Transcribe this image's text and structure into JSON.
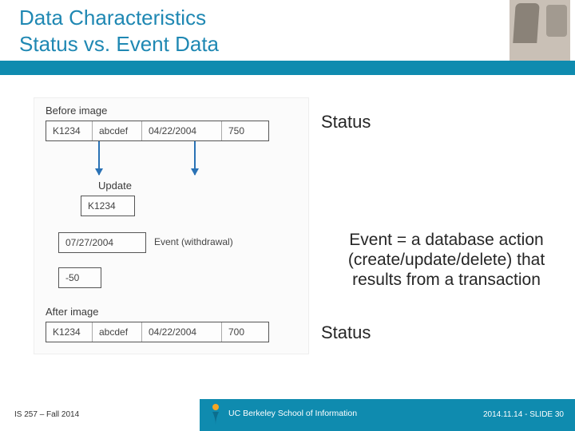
{
  "title": {
    "line1": "Data Characteristics",
    "line2": "Status vs. Event Data"
  },
  "diagram": {
    "before_label": "Before image",
    "before_row": {
      "c1": "K1234",
      "c2": "abcdef",
      "c3": "04/22/2004",
      "c4": "750"
    },
    "update_label": "Update",
    "update_cell": "K1234",
    "event_date": "07/27/2004",
    "event_label": "Event (withdrawal)",
    "event_amount": "-50",
    "after_label": "After image",
    "after_row": {
      "c1": "K1234",
      "c2": "abcdef",
      "c3": "04/22/2004",
      "c4": "700"
    }
  },
  "labels": {
    "status1": "Status",
    "status2": "Status",
    "event_text": "Event = a database action (create/update/delete) that results from a transaction"
  },
  "footer": {
    "left": "IS 257 – Fall 2014",
    "org": "UC Berkeley School of Information",
    "right": "2014.11.14 - SLIDE 30"
  }
}
